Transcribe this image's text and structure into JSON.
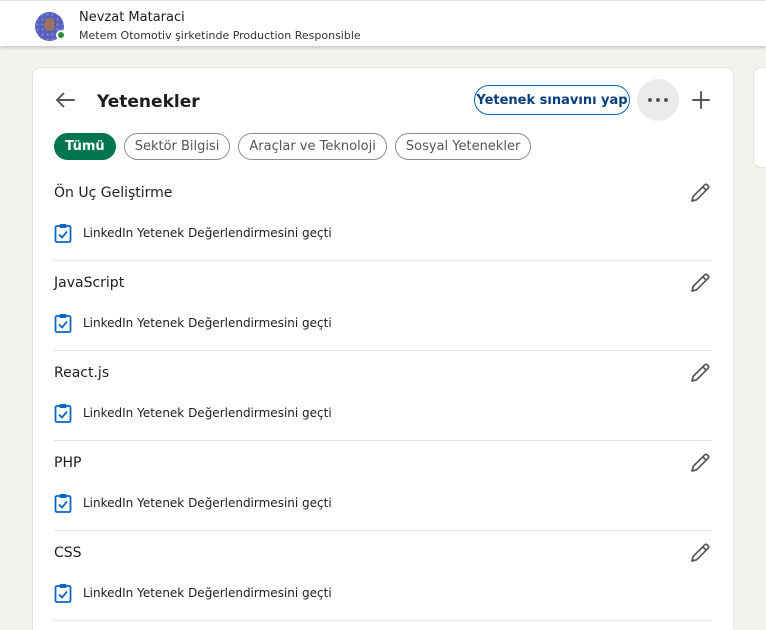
{
  "topbar": {
    "user_name": "Nevzat Mataraci",
    "user_title": "Metem Otomotiv şirketinde Production Responsible",
    "status_color": "#2e8a3c"
  },
  "page": {
    "title": "Yetenekler",
    "assessment_button": "Yetenek sınavını yap",
    "more_icon": "ellipsis-icon",
    "add_icon": "plus-icon",
    "back_icon": "arrow-left-icon"
  },
  "filters": [
    {
      "label": "Tümü",
      "active": true
    },
    {
      "label": "Sektör Bilgisi",
      "active": false
    },
    {
      "label": "Araçlar ve Teknoloji",
      "active": false
    },
    {
      "label": "Sosyal Yetenekler",
      "active": false
    }
  ],
  "skills": [
    {
      "name": "Ön Uç Geliştirme",
      "badge": "LinkedIn Yetenek Değerlendirmesini geçti"
    },
    {
      "name": "JavaScript",
      "badge": "LinkedIn Yetenek Değerlendirmesini geçti"
    },
    {
      "name": "React.js",
      "badge": "LinkedIn Yetenek Değerlendirmesini geçti"
    },
    {
      "name": "PHP",
      "badge": "LinkedIn Yetenek Değerlendirmesini geçti"
    },
    {
      "name": "CSS",
      "badge": "LinkedIn Yetenek Değerlendirmesini geçti"
    }
  ],
  "colors": {
    "accent": "#0a66c2",
    "active_chip": "#01754f"
  }
}
